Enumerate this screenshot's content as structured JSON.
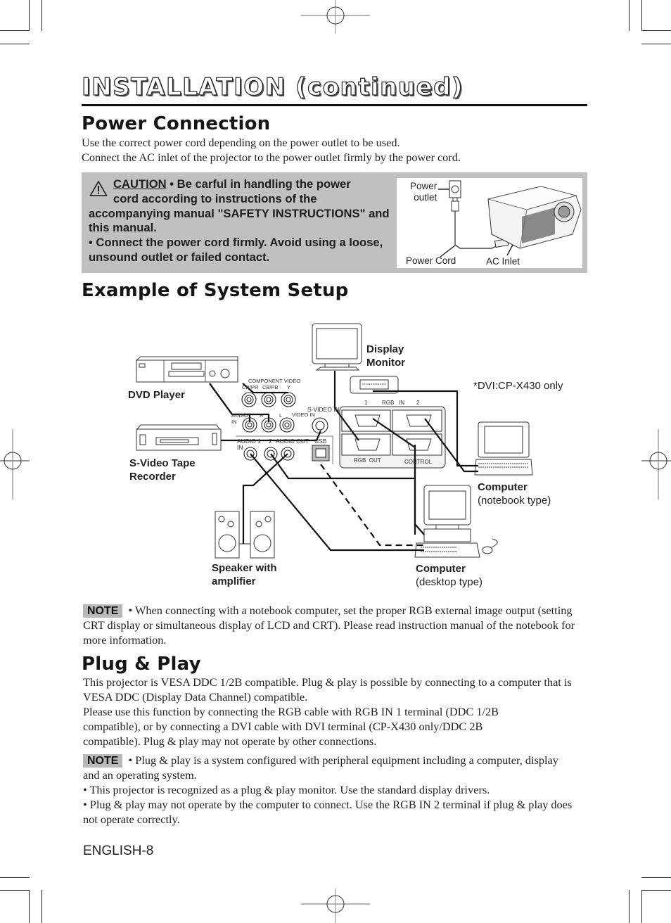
{
  "header": {
    "title": "INSTALLATION (continued)"
  },
  "power_connection": {
    "heading": "Power Connection",
    "paragraphs": [
      "Use the correct power cord depending on the power outlet to be used.",
      "Connect the AC inlet of the projector to the power outlet firmly by the power cord."
    ],
    "caution": {
      "icon": "warning-triangle-icon",
      "label": "CAUTION",
      "line1": " • Be carful in handling the power",
      "line2": "cord according to instructions of the",
      "rest": "accompanying manual \"SAFETY INSTRUCTIONS\" and this manual.",
      "bullet2": "• Connect the power cord firmly. Avoid using a loose, unsound outlet or failed contact."
    },
    "figure": {
      "power_outlet": "Power\noutlet",
      "power_outlet_line1": "Power",
      "power_outlet_line2": "outlet",
      "power_cord": "Power Cord",
      "ac_inlet": "AC Inlet"
    }
  },
  "system_setup": {
    "heading": "Example of System Setup",
    "labels": {
      "dvd_player": "DVD Player",
      "svideo_recorder_1": "S-Video Tape",
      "svideo_recorder_2": "Recorder",
      "display_monitor_1": "Display",
      "display_monitor_2": "Monitor",
      "dvi_note": "*DVI:CP-X430 only",
      "notebook_1": "Computer",
      "notebook_2": "(notebook type)",
      "desktop_1": "Computer",
      "desktop_2": "(desktop type)",
      "speaker_1": "Speaker with",
      "speaker_2": "amplifier"
    },
    "panel_labels": {
      "component_video": "COMPONENT VIDEO",
      "cr_pr": "CR/PR",
      "cb_pb": "CB/PB",
      "y": "Y",
      "audio_in": "AUDIO",
      "in": "IN",
      "r": "R",
      "l": "L",
      "video_in": "VIDEO IN",
      "svideo_in": "S-VIDEO IN",
      "audio1": "AUDIO 1",
      "in2": "IN",
      "two": "2",
      "audio_out": "AUDIO OUT",
      "usb": "USB",
      "rgb_in_1": "1",
      "rgb_in": "RGB   IN",
      "rgb_in_2": "2",
      "rgb_out": "RGB  OUT",
      "control": "CONTROL"
    }
  },
  "note1": {
    "badge": "NOTE",
    "text": "• When connecting with a notebook computer, set the proper RGB external image output (setting CRT display or simultaneous display of LCD and CRT). Please read instruction manual of the notebook for more information."
  },
  "plug_play": {
    "heading": "Plug & Play",
    "p1": "This projector is VESA DDC 1/2B compatible. Plug & play is possible by connecting to a computer that is VESA DDC (Display Data Channel) compatible.",
    "p2": "Please use this function by connecting the RGB cable with RGB IN 1 terminal (DDC 1/2B compatible), or by connecting a DVI cable with DVI terminal (CP-X430 only/DDC 2B compatible). Plug & play may not operate by other connections."
  },
  "note2": {
    "badge": "NOTE",
    "b1": "• Plug & play is a system configured with peripheral equipment including a computer, display and an operating system.",
    "b2": "• This projector is recognized as a plug & play monitor. Use the standard display drivers.",
    "b3": "• Plug & play may not operate by the computer to connect. Use the RGB IN 2 terminal if plug & play does not operate correctly."
  },
  "footer": {
    "page_label": "ENGLISH-8"
  }
}
